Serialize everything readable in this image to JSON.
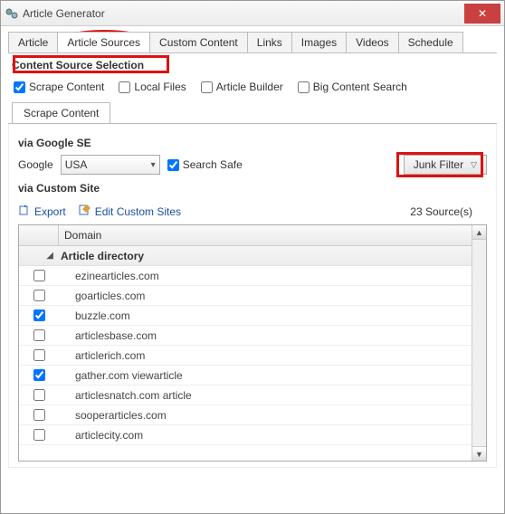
{
  "window": {
    "title": "Article Generator"
  },
  "tabs_top": [
    "Article",
    "Article Sources",
    "Custom Content",
    "Links",
    "Images",
    "Videos",
    "Schedule"
  ],
  "tabs_top_active": 1,
  "section_title": "Content Source Selection",
  "checks": {
    "scrape": {
      "label": "Scrape Content",
      "checked": true
    },
    "local": {
      "label": "Local Files",
      "checked": false
    },
    "builder": {
      "label": "Article Builder",
      "checked": false
    },
    "bigc": {
      "label": "Big Content Search",
      "checked": false
    }
  },
  "subtab_label": "Scrape Content",
  "via_google": "via Google SE",
  "google_label": "Google",
  "google_value": "USA",
  "search_safe": {
    "label": "Search Safe",
    "checked": true
  },
  "junk_filter_label": "Junk Filter",
  "via_custom": "via Custom Site",
  "export_label": "Export",
  "edit_label": "Edit Custom Sites",
  "sources_count": "23 Source(s)",
  "domain_header": "Domain",
  "category_label": "Article directory",
  "rows": [
    {
      "domain": "ezinearticles.com",
      "checked": false
    },
    {
      "domain": "goarticles.com",
      "checked": false
    },
    {
      "domain": "buzzle.com",
      "checked": true
    },
    {
      "domain": "articlesbase.com",
      "checked": false
    },
    {
      "domain": "articlerich.com",
      "checked": false
    },
    {
      "domain": "gather.com viewarticle",
      "checked": true
    },
    {
      "domain": "articlesnatch.com article",
      "checked": false
    },
    {
      "domain": "sooperarticles.com",
      "checked": false
    },
    {
      "domain": "articlecity.com",
      "checked": false
    }
  ]
}
